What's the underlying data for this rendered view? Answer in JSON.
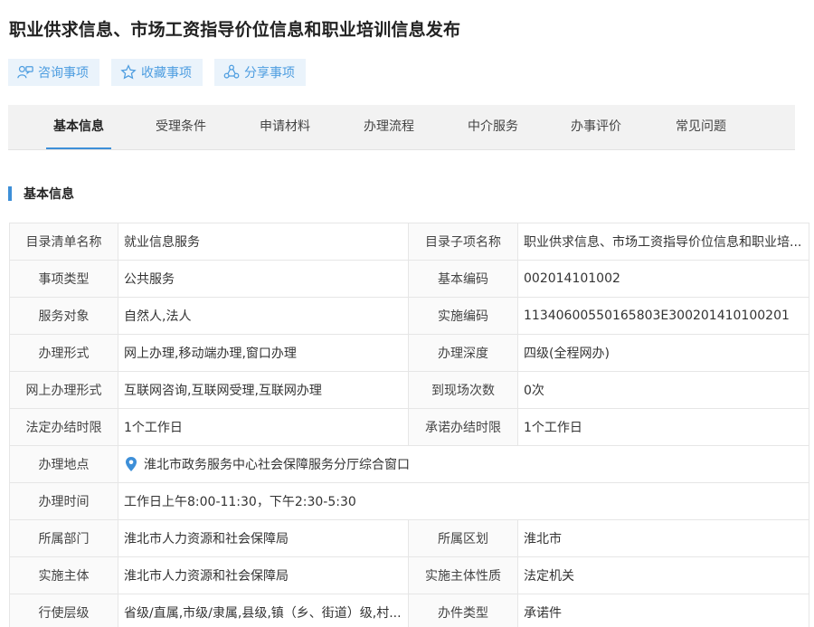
{
  "title": "职业供求信息、市场工资指导价位信息和职业培训信息发布",
  "actions": [
    {
      "label": "咨询事项",
      "icon": "consult-icon"
    },
    {
      "label": "收藏事项",
      "icon": "star-icon"
    },
    {
      "label": "分享事项",
      "icon": "share-icon"
    }
  ],
  "tabs": [
    "基本信息",
    "受理条件",
    "申请材料",
    "办理流程",
    "中介服务",
    "办事评价",
    "常见问题"
  ],
  "active_tab": "基本信息",
  "section_title": "基本信息",
  "rows": {
    "r1": {
      "l1": "目录清单名称",
      "v1": "就业信息服务",
      "l2": "目录子项名称",
      "v2": "职业供求信息、市场工资指导价位信息和职业培..."
    },
    "r2": {
      "l1": "事项类型",
      "v1": "公共服务",
      "l2": "基本编码",
      "v2": "002014101002"
    },
    "r3": {
      "l1": "服务对象",
      "v1": "自然人,法人",
      "l2": "实施编码",
      "v2": "11340600550165803E300201410100201"
    },
    "r4": {
      "l1": "办理形式",
      "v1": "网上办理,移动端办理,窗口办理",
      "l2": "办理深度",
      "v2": "四级(全程网办)"
    },
    "r5": {
      "l1": "网上办理形式",
      "v1": "互联网咨询,互联网受理,互联网办理",
      "l2": "到现场次数",
      "v2": "0次"
    },
    "r6": {
      "l1": "法定办结时限",
      "v1": "1个工作日",
      "l2": "承诺办结时限",
      "v2": "1个工作日"
    },
    "r7": {
      "l1": "办理地点",
      "v1": "淮北市政务服务中心社会保障服务分厅综合窗口"
    },
    "r8": {
      "l1": "办理时间",
      "v1": "工作日上午8:00-11:30，下午2:30-5:30"
    },
    "r9": {
      "l1": "所属部门",
      "v1": "淮北市人力资源和社会保障局",
      "l2": "所属区划",
      "v2": "淮北市"
    },
    "r10": {
      "l1": "实施主体",
      "v1": "淮北市人力资源和社会保障局",
      "l2": "实施主体性质",
      "v2": "法定机关"
    },
    "r11": {
      "l1": "行使层级",
      "v1": "省级/直属,市级/隶属,县级,镇（乡、街道）级,村...",
      "l2": "办件类型",
      "v2": "承诺件"
    }
  },
  "colors": {
    "accent": "#3d8fd8",
    "action_bg": "#eaf3fb",
    "action_text": "#4d9de0",
    "tab_bg": "#f2f2f2"
  }
}
